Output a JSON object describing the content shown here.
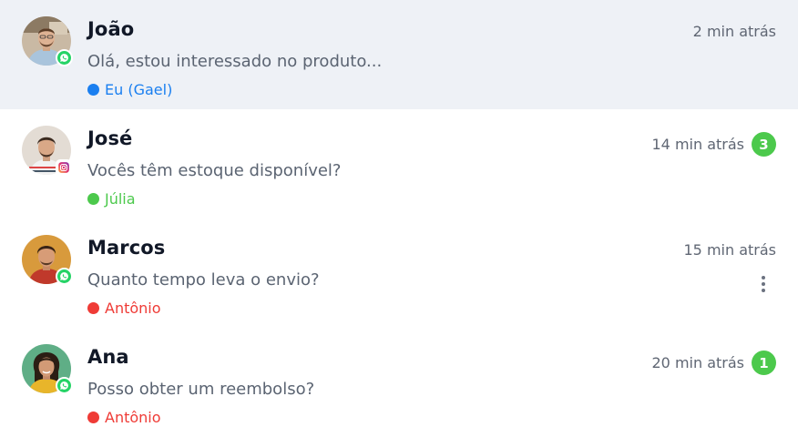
{
  "conversations": [
    {
      "name": "João",
      "message": "Olá, estou interessado no produto...",
      "time": "2 min atrás",
      "badge": "",
      "agent": "Eu (Gael)",
      "agent_color": "#1a7ff0",
      "channel": "whatsapp-icon",
      "selected": true
    },
    {
      "name": "José",
      "message": "Vocês têm estoque disponível?",
      "time": "14 min atrás",
      "badge": "3",
      "agent": "Júlia",
      "agent_color": "#4cc94c",
      "channel": "instagram-icon",
      "selected": false
    },
    {
      "name": "Marcos",
      "message": "Quanto tempo leva o envio?",
      "time": "15 min atrás",
      "badge": "",
      "agent": "Antônio",
      "agent_color": "#ef3b36",
      "channel": "whatsapp-icon",
      "selected": false
    },
    {
      "name": "Ana",
      "message": "Posso obter um reembolso?",
      "time": "20 min atrás",
      "badge": "1",
      "agent": "Antônio",
      "agent_color": "#ef3b36",
      "channel": "whatsapp-icon",
      "selected": false
    }
  ],
  "colors": {
    "selected_row_bg": "#eef1f6",
    "badge_bg": "#4cc94c",
    "whatsapp": "#25d366"
  }
}
